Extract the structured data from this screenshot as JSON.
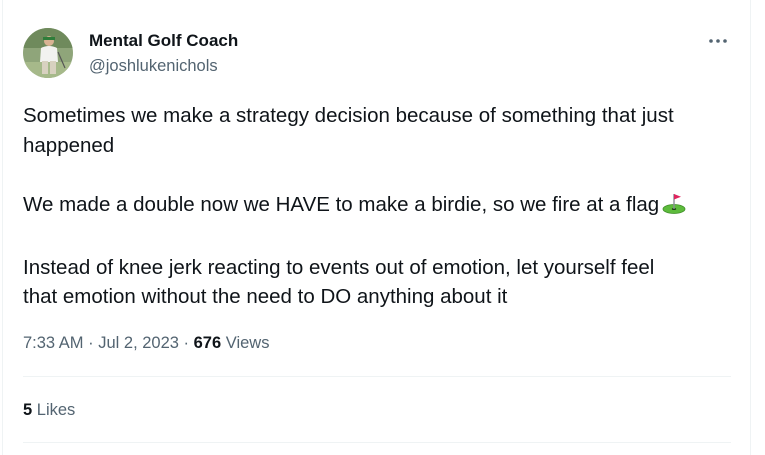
{
  "author": {
    "name": "Mental Golf Coach",
    "handle": "@joshlukenichols"
  },
  "tweet": {
    "paragraphs": [
      [
        "Sometimes we make a strategy decision because of something that just",
        "happened"
      ],
      [
        "We made a double now we HAVE to make a birdie, so we fire at a flag"
      ],
      [
        "Instead of knee jerk reacting to events out of emotion, let yourself feel",
        "that emotion without the need to DO anything about it"
      ]
    ],
    "emoji": "flag-in-hole"
  },
  "meta": {
    "time": "7:33 AM",
    "sep1": " · ",
    "date": "Jul 2, 2023",
    "sep2": " · ",
    "views_count": "676",
    "views_label": " Views"
  },
  "engagement": {
    "likes_count": "5",
    "likes_label": " Likes"
  },
  "colors": {
    "text": "#0f1419",
    "secondary": "#536471",
    "divider": "#eff3f4"
  }
}
